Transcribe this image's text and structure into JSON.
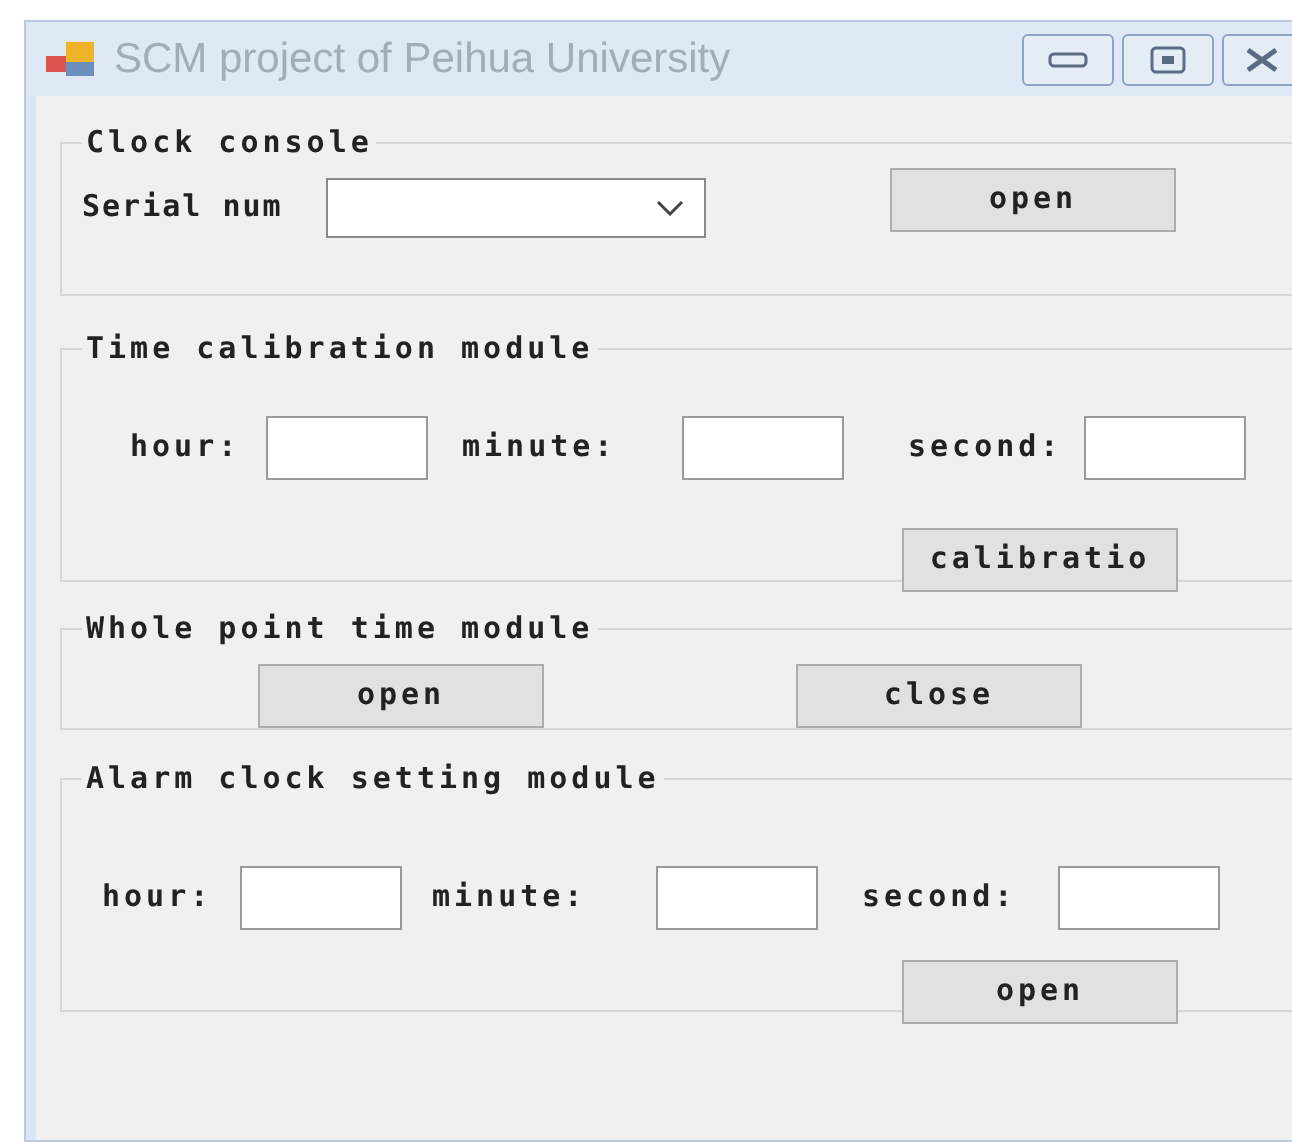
{
  "window": {
    "title": "SCM project of Peihua University"
  },
  "clock_console": {
    "title": "Clock console",
    "serial_label": "Serial num",
    "open_button": "open"
  },
  "time_calibration": {
    "title": "Time calibration module",
    "fields": [
      {
        "label": "hour:"
      },
      {
        "label": "minute:"
      },
      {
        "label": "second:"
      }
    ],
    "button": "calibratio"
  },
  "whole_point": {
    "title": "Whole point time module",
    "buttons": [
      "open",
      "close"
    ]
  },
  "alarm_clock": {
    "title": "Alarm clock setting module",
    "fields": [
      {
        "label": "hour:"
      },
      {
        "label": "minute:"
      },
      {
        "label": "second:"
      }
    ],
    "button": "open"
  }
}
